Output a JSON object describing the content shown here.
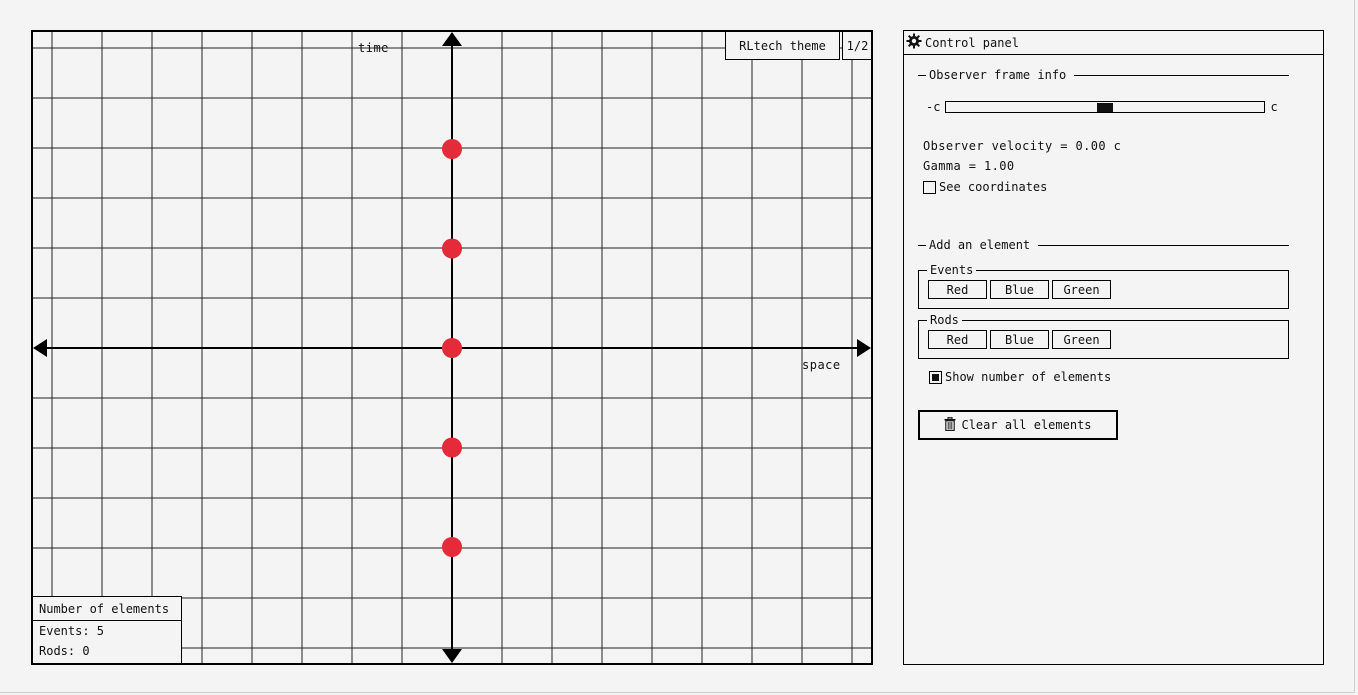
{
  "diagram": {
    "time_label": "time",
    "space_label": "space",
    "theme_button": "RLtech theme",
    "page_button": "1/2",
    "events": [
      {
        "color": "#e52a3a",
        "x": 0,
        "t": 2
      },
      {
        "color": "#e52a3a",
        "x": 0,
        "t": 1
      },
      {
        "color": "#e52a3a",
        "x": 0,
        "t": 0
      },
      {
        "color": "#e52a3a",
        "x": 0,
        "t": -1
      },
      {
        "color": "#e52a3a",
        "x": 0,
        "t": -2
      }
    ],
    "count_box": {
      "title": "Number of elements",
      "events_text": "Events: 5",
      "rods_text": "Rods: 0"
    }
  },
  "panel": {
    "title": "Control panel",
    "icon": "gear-icon",
    "observer": {
      "section_title": "Observer frame info",
      "slider_min_label": "-c",
      "slider_max_label": "c",
      "slider_value": 0.5,
      "velocity_text": "Observer velocity = 0.00 c",
      "gamma_text": "Gamma = 1.00",
      "see_coordinates_label": "See coordinates",
      "see_coordinates_checked": false
    },
    "add": {
      "section_title": "Add an element",
      "events_legend": "Events",
      "rods_legend": "Rods",
      "event_buttons": [
        "Red",
        "Blue",
        "Green"
      ],
      "rod_buttons": [
        "Red",
        "Blue",
        "Green"
      ],
      "show_number_label": "Show number of elements",
      "show_number_checked": true,
      "clear_label": "Clear all elements",
      "clear_icon": "trash-icon"
    }
  },
  "colors": {
    "event_red": "#e52a3a",
    "background": "#f4f4f4",
    "ink": "#000000"
  }
}
